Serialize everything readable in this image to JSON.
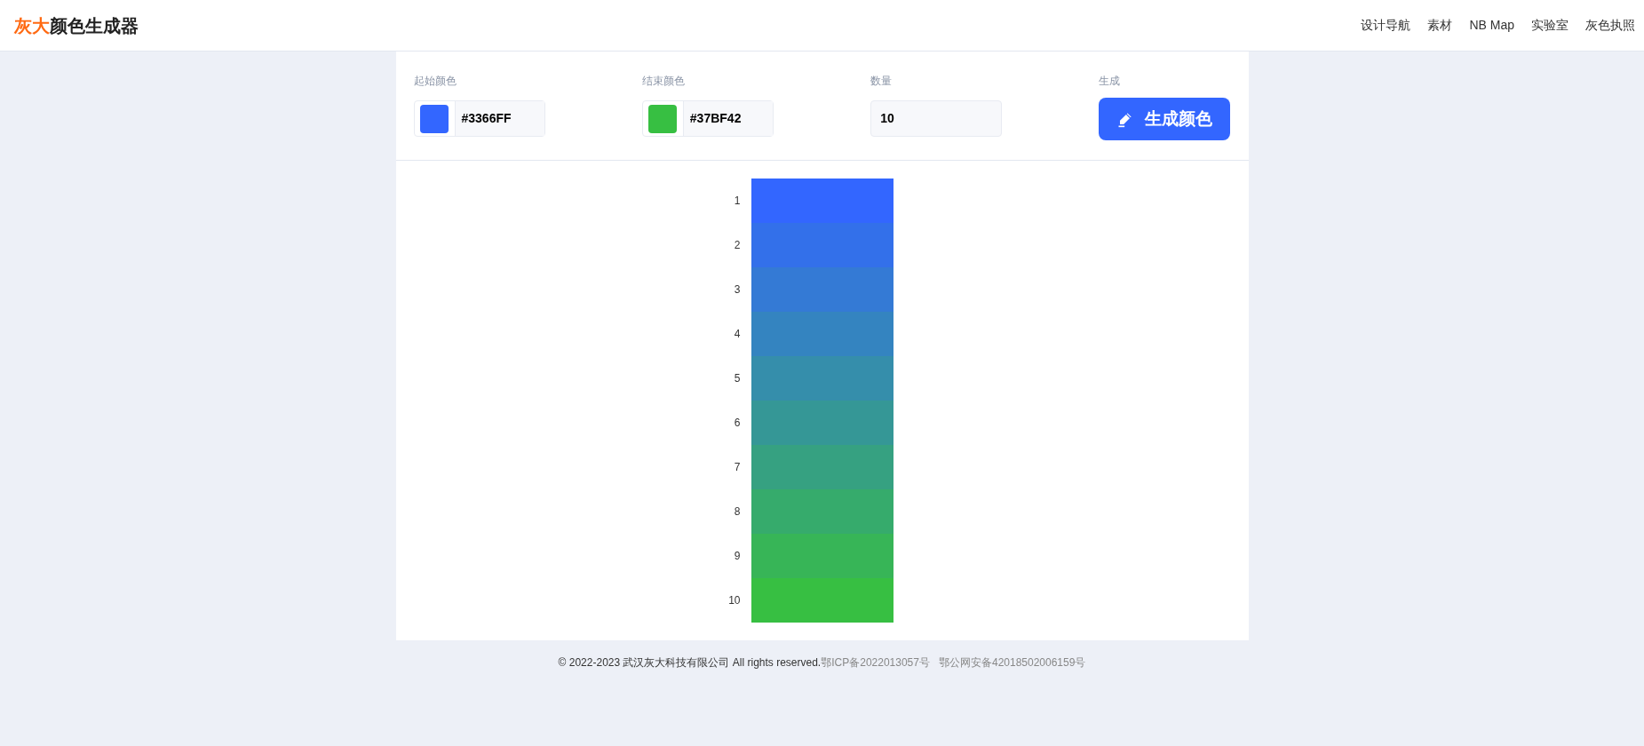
{
  "header": {
    "logo_accent": "灰大",
    "logo_rest": "颜色生成器",
    "nav": [
      "设计导航",
      "素材",
      "NB Map",
      "实验室",
      "灰色执照"
    ]
  },
  "controls": [
    {
      "kind": "color",
      "label": "起始颜色",
      "value": "#3366FF",
      "color": "#3366ff"
    },
    {
      "kind": "color",
      "label": "结束颜色",
      "value": "#37BF42",
      "color": "#37bf42"
    },
    {
      "kind": "number",
      "label": "数量",
      "value": "10"
    },
    {
      "kind": "button",
      "label": "生成",
      "button": "生成颜色"
    }
  ],
  "swatches": [
    {
      "label": "1",
      "color": "#3366ff"
    },
    {
      "label": "2",
      "color": "#3370ea"
    },
    {
      "label": "3",
      "color": "#347ad5"
    },
    {
      "label": "4",
      "color": "#3484c0"
    },
    {
      "label": "5",
      "color": "#358eab"
    },
    {
      "label": "6",
      "color": "#359796"
    },
    {
      "label": "7",
      "color": "#36a181"
    },
    {
      "label": "8",
      "color": "#36ab6c"
    },
    {
      "label": "9",
      "color": "#37b557"
    },
    {
      "label": "10",
      "color": "#37bf42"
    }
  ],
  "footer": {
    "copyright": "© 2022-2023 武汉灰大科技有限公司 All rights reserved.",
    "links": [
      "鄂ICP备2022013057号",
      "鄂公网安备42018502006159号"
    ]
  }
}
